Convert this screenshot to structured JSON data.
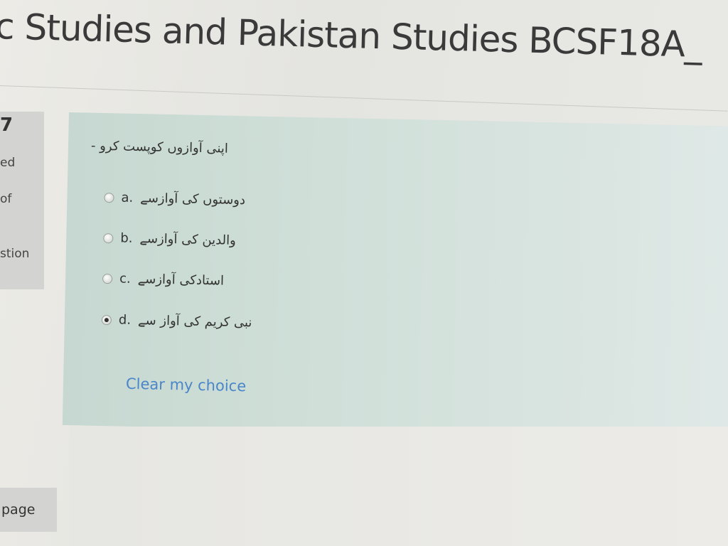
{
  "header": {
    "course_title": "c Studies and Pakistan Studies BCSF18A_"
  },
  "question_info": {
    "number": "7",
    "line1": "ed",
    "line2": "of",
    "line3": "stion"
  },
  "question": {
    "text": "اپنی آوازوں کوپست کرو -",
    "answers": [
      {
        "letter": "a.",
        "text": "دوستوں کی آوازسے",
        "checked": false
      },
      {
        "letter": "b.",
        "text": "والدین کی آوازسے",
        "checked": false
      },
      {
        "letter": "c.",
        "text": "استادکی آوازسے",
        "checked": false
      },
      {
        "letter": "d.",
        "text": "نبی کریم کی آواز سے",
        "checked": true
      }
    ],
    "clear_label": "Clear my choice"
  },
  "navigation": {
    "page_label": "page"
  },
  "colors": {
    "question_bg": "#cfdfd8",
    "link": "#4a86c8",
    "info_panel_bg": "#d3d4d1"
  }
}
